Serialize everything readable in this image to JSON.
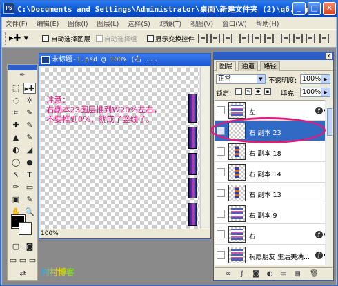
{
  "window": {
    "title": "C:\\Documents and Settings\\Administrator\\桌面\\新建文件夹 (2)\\q6.jpg",
    "app_icon": "PS",
    "minimize_glyph": "_",
    "maximize_glyph": "□",
    "close_glyph": "✕"
  },
  "menubar": {
    "items": [
      "文件(F)",
      "编辑(E)",
      "图像(I)",
      "图层(L)",
      "选择(S)",
      "滤镜(T)",
      "视图(V)",
      "窗口(W)",
      "帮助(H)"
    ]
  },
  "options_bar": {
    "tool_glyph": "▸✚ ▾",
    "auto_select_layer": "自动选择图层",
    "auto_select_group": "自动选择组",
    "show_transform": "显示变换控件"
  },
  "toolbox": {
    "feather_glyph": "✒",
    "tools": [
      [
        "⬚",
        "▸✚"
      ],
      [
        "◌",
        "✲"
      ],
      [
        "⌗",
        "✎"
      ],
      [
        "✚",
        "✎"
      ],
      [
        "▲",
        "✎"
      ],
      [
        "◐",
        "◢"
      ],
      [
        "◯",
        "●"
      ],
      [
        "↖",
        "T"
      ],
      [
        "✑",
        "▭"
      ],
      [
        "▣",
        "✎"
      ],
      [
        "✋",
        "🔍"
      ]
    ],
    "mask_glyphs": [
      "▢",
      "◙"
    ],
    "screen_glyphs": [
      "▭",
      "▭",
      "▭"
    ],
    "jump_glyph": "⇄"
  },
  "document": {
    "title": "未标题-1.psd @ 100% (右 ...",
    "zoom": "100%",
    "note_lines": [
      "注意：",
      "右副本23图层推到W20%左右，",
      "不要推到0%，就成了竖线了。"
    ]
  },
  "layers_panel": {
    "tabs": [
      "图层",
      "通道",
      "路径"
    ],
    "blend_mode": "正常",
    "opacity_label": "不透明度:",
    "opacity_value": "100%",
    "lock_label": "锁定:",
    "fill_label": "填充:",
    "fill_value": "100%",
    "layers": [
      {
        "name": "左",
        "fx": true,
        "thumb": "art"
      },
      {
        "name": "右 副本 23",
        "fx": false,
        "thumb": "blank",
        "selected": true
      },
      {
        "name": "右 副本 18",
        "fx": false,
        "thumb": "col"
      },
      {
        "name": "右 副本 14",
        "fx": false,
        "thumb": "col"
      },
      {
        "name": "右 副本 13",
        "fx": false,
        "thumb": "col"
      },
      {
        "name": "右 副本 9",
        "fx": false,
        "thumb": "art"
      },
      {
        "name": "右",
        "fx": true,
        "thumb": "art"
      },
      {
        "name": "祝愿朋友 生活美满...",
        "fx": true,
        "thumb": "art"
      }
    ],
    "bottom_glyphs": [
      "∞",
      "ƒ",
      "◙",
      "◐",
      "▭",
      "▤",
      "🗑"
    ]
  },
  "watermark": "村村博客"
}
